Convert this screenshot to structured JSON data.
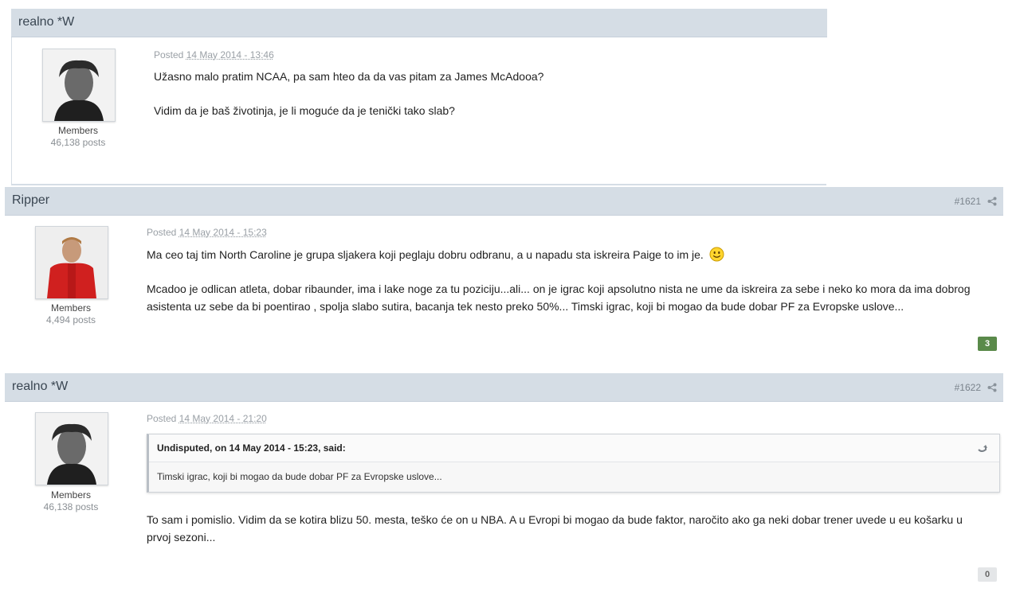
{
  "colors": {
    "header_bg": "#d5dde5",
    "rep_positive": "#5a8a4a",
    "rep_neutral": "#e4e6e8"
  },
  "posts": [
    {
      "author": "realno *W",
      "group": "Members",
      "post_count": "46,138 posts",
      "posted_label": "Posted",
      "date": "14 May 2014 - 13:46",
      "paragraphs": [
        "Užasno malo pratim NCAA, pa sam hteo da da vas pitam za James McAdooa?",
        "Vidim da je baš životinja, je li moguće da je tenički tako slab?"
      ]
    },
    {
      "author": "Ripper",
      "post_number": "#1621",
      "group": "Members",
      "post_count": "4,494 posts",
      "posted_label": "Posted",
      "date": "14 May 2014 - 15:23",
      "paragraphs": [
        "Ma ceo taj tim North Caroline je grupa sljakera koji peglaju dobru odbranu, a u napadu sta iskreira Paige to im je.",
        "Mcadoo je odlican atleta, dobar ribaunder, ima i lake noge za tu poziciju...ali... on je igrac koji apsolutno nista ne ume da iskreira za sebe i neko ko mora da ima dobrog asistenta uz sebe da bi poentirao , spolja slabo sutira, bacanja tek nesto preko 50%... Timski igrac, koji bi mogao da bude dobar PF za Evropske uslove..."
      ],
      "reputation": "3"
    },
    {
      "author": "realno *W",
      "post_number": "#1622",
      "group": "Members",
      "post_count": "46,138 posts",
      "posted_label": "Posted",
      "date": "14 May 2014 - 21:20",
      "quote": {
        "citation": "Undisputed, on 14 May 2014 - 15:23, said:",
        "text": "Timski igrac, koji bi mogao da bude dobar PF za Evropske uslove..."
      },
      "paragraphs": [
        "To sam i pomislio. Vidim da se kotira blizu 50. mesta, teško će on u NBA. A u Evropi bi mogao da bude faktor, naročito ako ga neki dobar trener uvede u eu košarku u prvoj sezoni..."
      ],
      "reputation": "0"
    }
  ]
}
